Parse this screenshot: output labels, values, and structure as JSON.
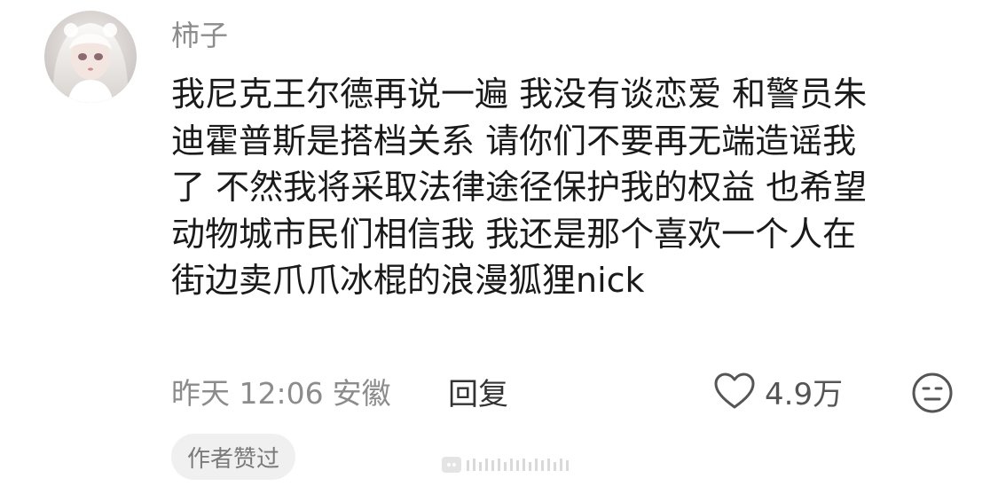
{
  "comment": {
    "username": "柿子",
    "avatar_icon": "avatar-girl-white-hair",
    "content_lines": [
      "我尼克王尔德再说一遍 我没有谈恋爱 和警员朱",
      "迪霍普斯是搭档关系 请你们不要再无端造谣我",
      "了 不然我将采取法律途径保护我的权益 也希望",
      "动物城市民们相信我 我还是那个喜欢一个人在",
      "街边卖爪爪冰棍的浪漫狐狸nick"
    ],
    "time": "昨天 12:06",
    "location": "安徽",
    "reply_label": "回复",
    "like_icon": "heart-outline-icon",
    "like_count": "4.9万",
    "dislike_icon": "neutral-face-icon",
    "author_badge": "作者赞过",
    "watermark_icon": "bilibili-watermark"
  },
  "colors": {
    "text_primary": "#1a1a1a",
    "text_secondary": "#8c8c8c",
    "badge_bg": "#f0f0f0"
  }
}
